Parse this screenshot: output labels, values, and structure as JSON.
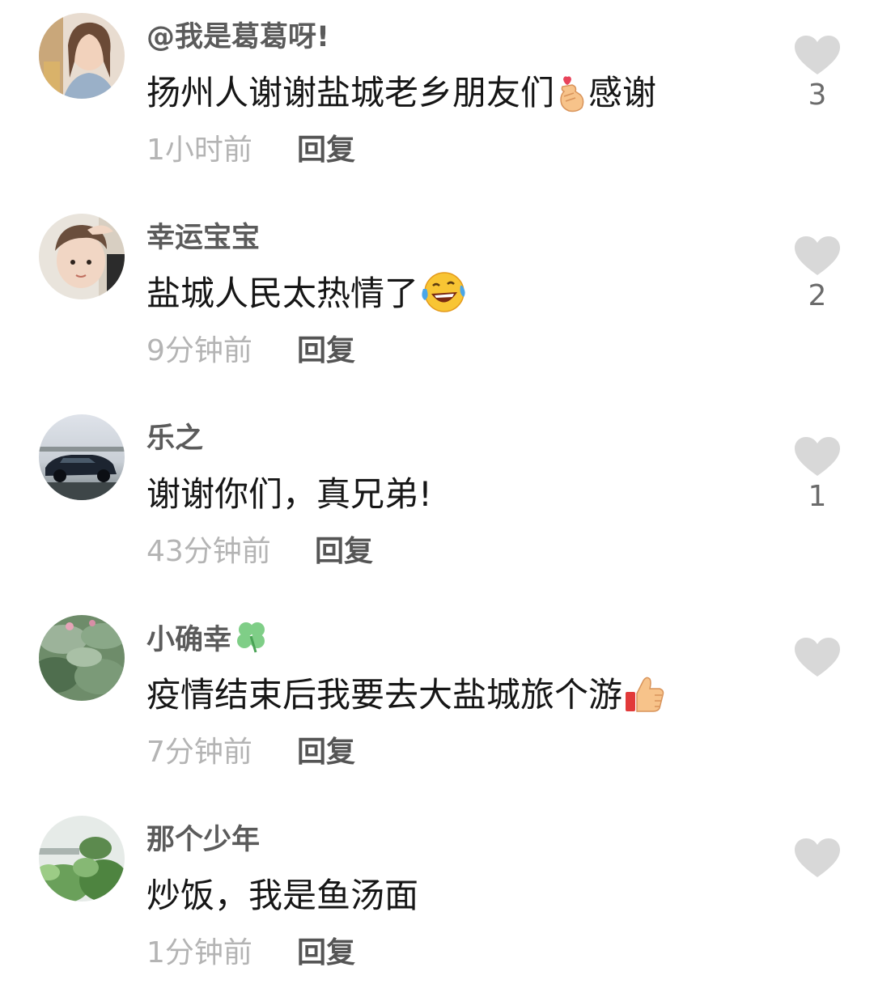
{
  "comments": [
    {
      "username": "@我是葛葛呀!",
      "text_before": "扬州人谢谢盐城老乡朋友们",
      "emoji_mid": "finger-heart-icon",
      "text_after": "感谢",
      "time": "1小时前",
      "reply": "回复",
      "likes": "3",
      "avatar": "woman-portrait-avatar"
    },
    {
      "username": "幸运宝宝",
      "text_before": "盐城人民太热情了",
      "emoji_end": "laughing-tears-icon",
      "time": "9分钟前",
      "reply": "回复",
      "likes": "2",
      "avatar": "child-portrait-avatar"
    },
    {
      "username": "乐之",
      "text_before": "谢谢你们，真兄弟!",
      "time": "43分钟前",
      "reply": "回复",
      "likes": "1",
      "avatar": "car-lake-avatar"
    },
    {
      "username": "小确幸",
      "username_emoji": "four-leaf-clover-icon",
      "text_before": "疫情结束后我要去大盐城旅个游",
      "emoji_end": "thumbs-up-icon",
      "time": "7分钟前",
      "reply": "回复",
      "likes": "",
      "avatar": "lotus-leaves-avatar"
    },
    {
      "username": "那个少年",
      "text_before": "炒饭，我是鱼汤面",
      "time": "1分钟前",
      "reply": "回复",
      "likes": "",
      "avatar": "green-plant-avatar"
    }
  ],
  "colors": {
    "username": "#5b5b5b",
    "text": "#161616",
    "time": "#b4b4b4",
    "reply": "#555555",
    "heart": "#d8d8d8"
  }
}
